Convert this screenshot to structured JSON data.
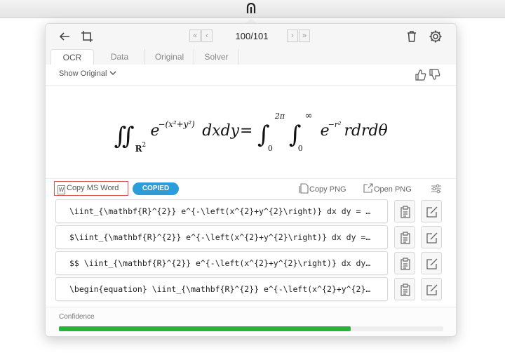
{
  "app": {
    "page_count": "100/101"
  },
  "tabs": [
    {
      "label": "OCR",
      "active": true
    },
    {
      "label": "Data",
      "active": false
    },
    {
      "label": "Original",
      "active": false
    },
    {
      "label": "Solver",
      "active": false
    }
  ],
  "subbar": {
    "show_original": "Show Original"
  },
  "actions": {
    "copy_ms_word": "Copy MS Word",
    "copied_badge": "COPIED",
    "copy_png": "Copy PNG",
    "open_png": "Open PNG"
  },
  "results": [
    {
      "latex": "\\iint_{\\mathbf{R}^{2}} e^{-\\left(x^{2}+y^{2}\\right)} dx dy = \\int_{0}^{2\\pi} \\int_{0}^{\\infty} e^{-r^{2}} r dr d\\theta"
    },
    {
      "latex": "$\\iint_{\\mathbf{R}^{2}} e^{-\\left(x^{2}+y^{2}\\right)} dx dy = \\int_{0}^{2\\pi} \\int_{0}^{\\infty} e^{-r^{2}} r dr d\\theta$"
    },
    {
      "latex": "$$ \\iint_{\\mathbf{R}^{2}} e^{-\\left(x^{2}+y^{2}\\right)} dx dy = \\int_{0}^{2\\pi} \\int_{0}^{\\infty} e^{-r^{2}} r dr d\\theta $$"
    },
    {
      "latex": "\\begin{equation} \\iint_{\\mathbf{R}^{2}} e^{-\\left(x^{2}+y^{2}\\right)} dx dy = \\int_{0}^{2\\pi} \\int_{0}^{\\infty} e^{-r^{2}} r dr d\\theta \\end{equation}"
    }
  ],
  "confidence": {
    "label": "Confidence",
    "value": 0.76
  },
  "colors": {
    "accent_blue": "#2d9cdb",
    "confidence_green": "#27b33a",
    "highlight_red": "#d9534f"
  },
  "icons": [
    "app-menubar-icon",
    "back-arrow-icon",
    "crop-icon",
    "first-page-icon",
    "prev-page-icon",
    "next-page-icon",
    "last-page-icon",
    "trash-icon",
    "gear-icon",
    "chevron-down-icon",
    "thumbs-up-icon",
    "thumbs-down-icon",
    "word-doc-icon",
    "copy-png-icon",
    "open-png-icon",
    "settings-sliders-icon",
    "clipboard-icon",
    "edit-icon"
  ]
}
